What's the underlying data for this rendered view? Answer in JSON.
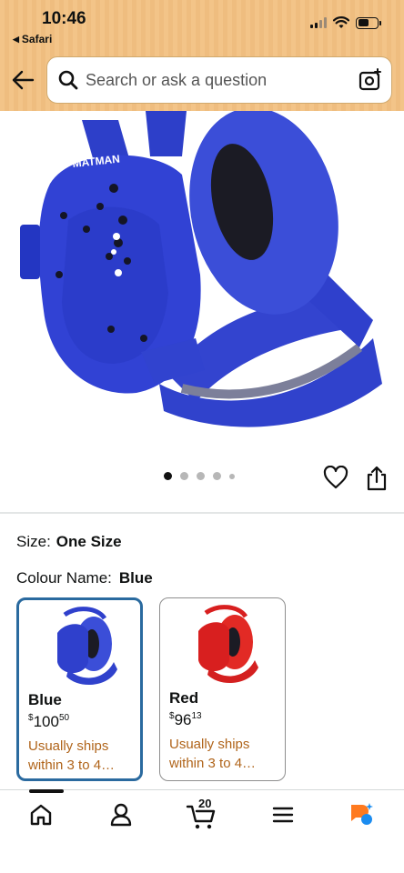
{
  "status_bar": {
    "time": "10:46",
    "back_app": "Safari"
  },
  "search": {
    "placeholder": "Search or ask a question"
  },
  "carousel": {
    "total": 5,
    "active": 1
  },
  "product": {
    "size_label": "Size:",
    "size_value": "One Size",
    "colour_label": "Colour Name:",
    "colour_value": "Blue",
    "variants": [
      {
        "name": "Blue",
        "price_currency": "$",
        "price_whole": "100",
        "price_fraction": "50",
        "shipping": "Usually ships within 3 to 4…",
        "selected": true,
        "color": "#2f3fd6"
      },
      {
        "name": "Red",
        "price_currency": "$",
        "price_whole": "96",
        "price_fraction": "13",
        "shipping": "Usually ships within 3 to 4…",
        "selected": false,
        "color": "#e0201f"
      }
    ],
    "image_brand_text": "MATMAN"
  },
  "bottom_nav": {
    "cart_count": "20",
    "items": [
      "home-icon",
      "account-icon",
      "cart-icon",
      "menu-icon",
      "rufus-icon"
    ]
  },
  "colors": {
    "accent_blue": "#2a6a9f",
    "shipping_orange": "#b0641a",
    "header": "#f3c488"
  }
}
